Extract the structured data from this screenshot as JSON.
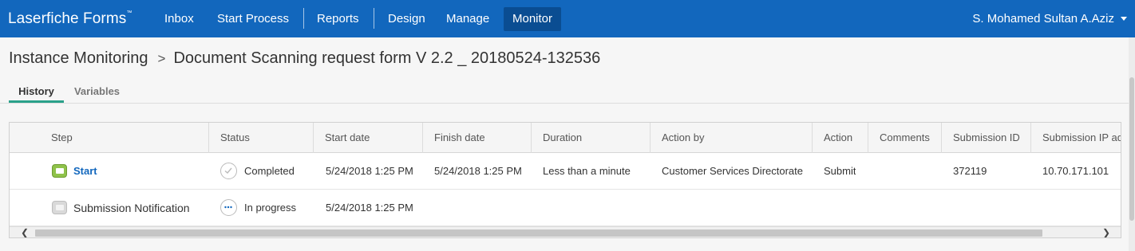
{
  "header": {
    "brand": "Laserfiche Forms",
    "brand_tm": "™",
    "nav": [
      "Inbox",
      "Start Process",
      "Reports",
      "Design",
      "Manage",
      "Monitor"
    ],
    "active_nav": "Monitor",
    "user_name": "S. Mohamed Sultan A.Aziz",
    "colors": {
      "bar": "#1267bd",
      "active": "#0a4d92"
    }
  },
  "breadcrumb": {
    "parent": "Instance Monitoring",
    "separator": ">",
    "current": "Document Scanning request form V 2.2 _ 20180524-132536"
  },
  "tabs": [
    {
      "label": "History",
      "active": true
    },
    {
      "label": "Variables",
      "active": false
    }
  ],
  "grid": {
    "columns": [
      "Step",
      "Status",
      "Start date",
      "Finish date",
      "Duration",
      "Action by",
      "Action",
      "Comments",
      "Submission ID",
      "Submission IP ad"
    ],
    "rows": [
      {
        "step": "Start",
        "step_icon": "form-start-icon",
        "status": "Completed",
        "status_icon": "check-circle-icon",
        "start_date": "5/24/2018 1:25 PM",
        "finish_date": "5/24/2018 1:25 PM",
        "duration": "Less than a minute",
        "action_by": "Customer Services Directorate",
        "action": "Submit",
        "comments": "",
        "submission_id": "372119",
        "submission_ip": "10.70.171.101"
      },
      {
        "step": "Submission Notification",
        "step_icon": "email-icon",
        "status": "In progress",
        "status_icon": "ellipsis-circle-icon",
        "start_date": "5/24/2018 1:25 PM",
        "finish_date": "",
        "duration": "",
        "action_by": "",
        "action": "",
        "comments": "",
        "submission_id": "",
        "submission_ip": ""
      }
    ],
    "scroll_left_glyph": "❮",
    "scroll_right_glyph": "❯"
  }
}
